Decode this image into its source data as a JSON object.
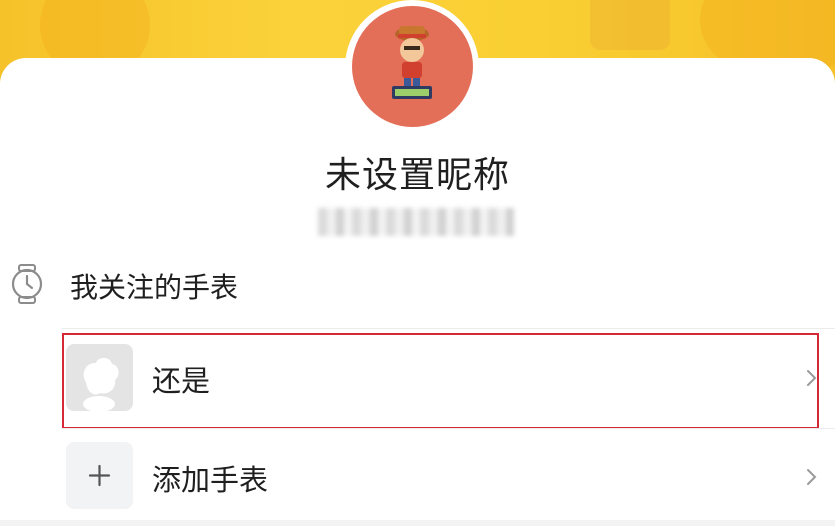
{
  "profile": {
    "nickname": "未设置昵称",
    "account_id": ""
  },
  "watches_section": {
    "title": "我关注的手表",
    "icon": "watch-icon",
    "items": [
      {
        "label": "还是",
        "icon": "device-avatar-icon",
        "selected": true
      },
      {
        "label": "添加手表",
        "icon": "plus-icon",
        "selected": false
      }
    ]
  },
  "colors": {
    "banner": "#f9cf33",
    "avatar_bg": "#e46f58",
    "highlight_border": "#d52a36",
    "text": "#1f1f1f"
  }
}
